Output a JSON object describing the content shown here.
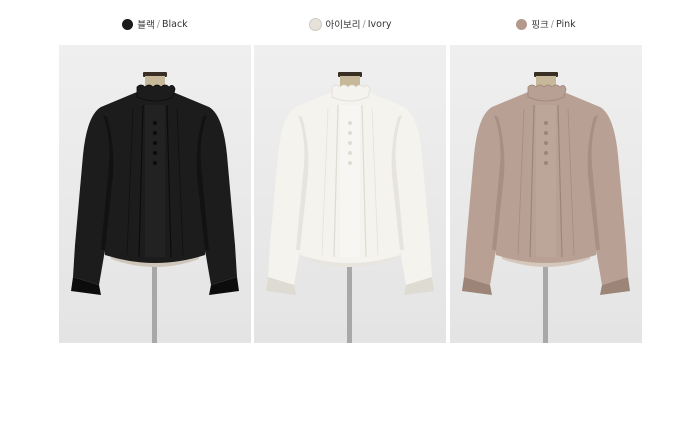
{
  "colors": [
    {
      "name_ko": "블랙",
      "separator": "/",
      "name_en": "Black",
      "swatch": "#1a1a1a",
      "body": "#1c1c1c",
      "shade": "#0c0c0c",
      "highlight": "#333333",
      "lining": "#cfc6ba"
    },
    {
      "name_ko": "아이보리",
      "separator": "/",
      "name_en": "Ivory",
      "swatch": "#e6e2d9",
      "body": "#f5f3ee",
      "shade": "#dedbd3",
      "highlight": "#ffffff",
      "lining": "#e8e5de"
    },
    {
      "name_ko": "핑크",
      "separator": "/",
      "name_en": "Pink",
      "swatch": "#b49a8c",
      "body": "#b8a194",
      "shade": "#9c8477",
      "highlight": "#c9b4a8",
      "lining": "#d6c7bc"
    }
  ],
  "mannequin": {
    "stand": "#a8a8a8",
    "neck": "#c8b89a",
    "cap": "#3a2f24"
  }
}
